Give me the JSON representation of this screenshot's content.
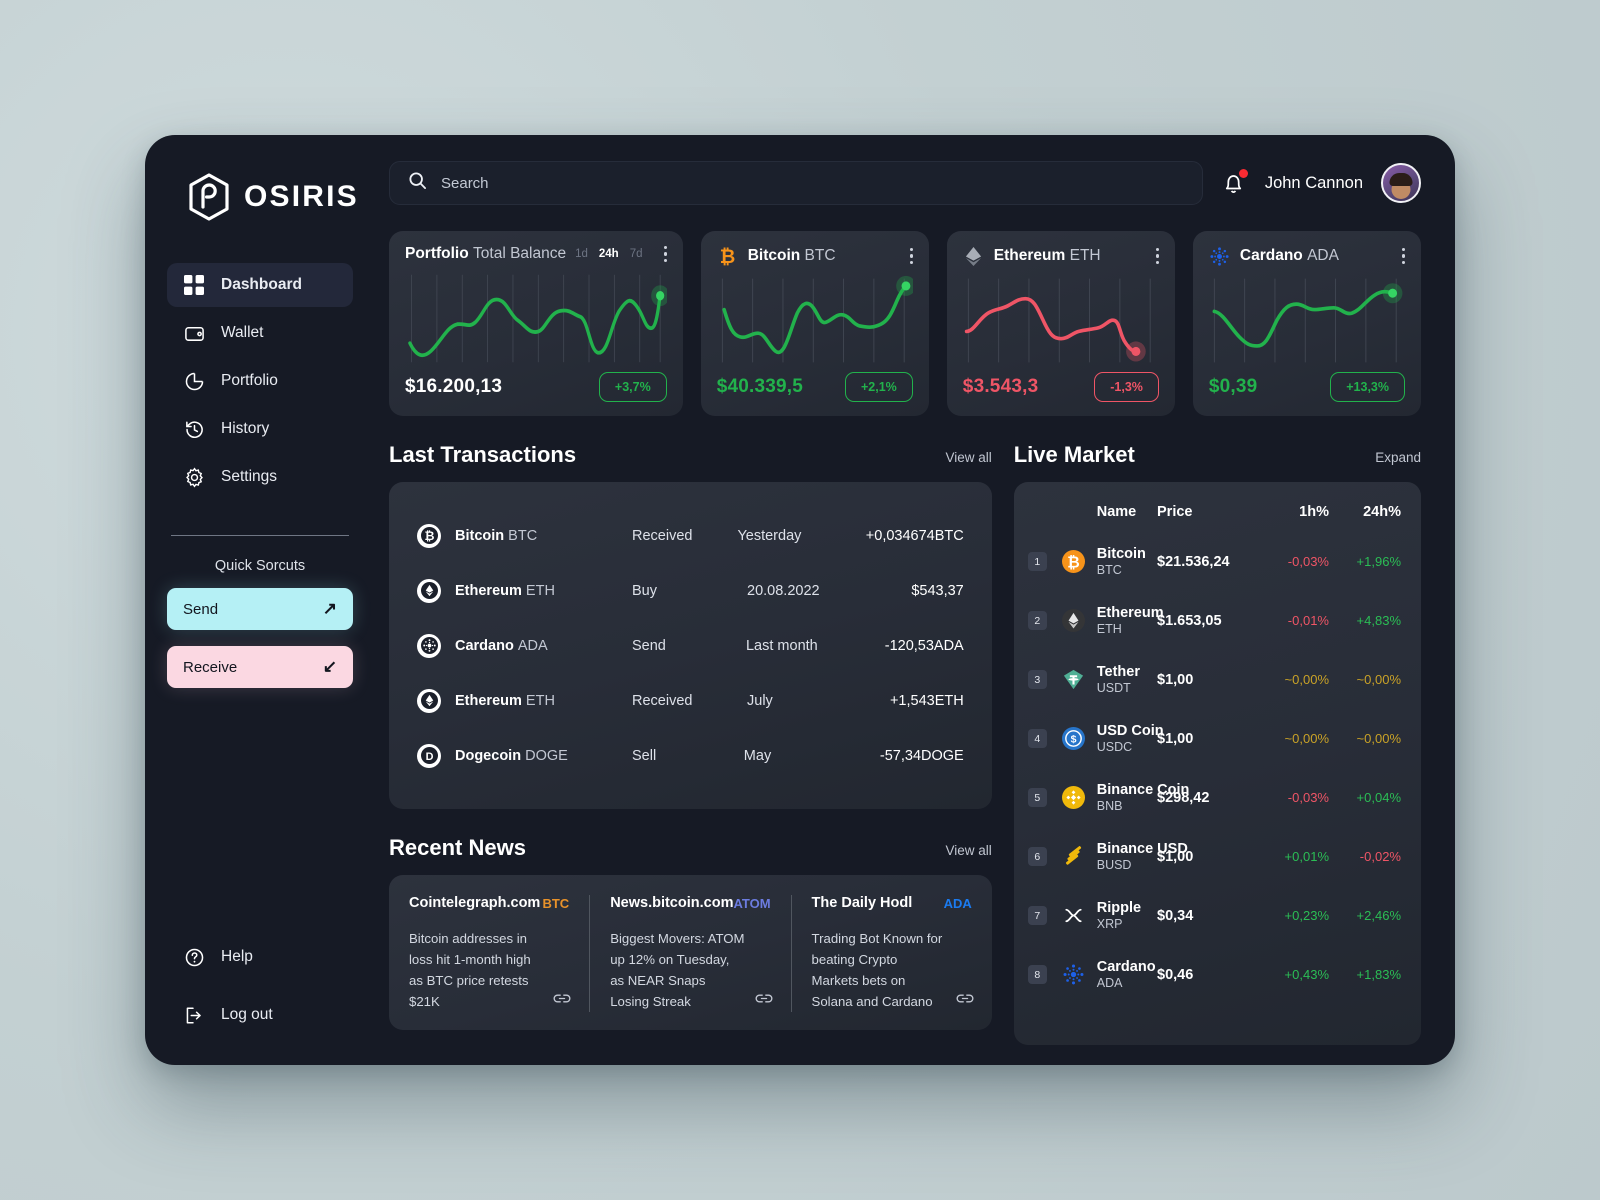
{
  "brand": {
    "name": "OSIRIS"
  },
  "sidebar": {
    "items": [
      {
        "label": "Dashboard",
        "icon": "grid-icon",
        "active": true
      },
      {
        "label": "Wallet",
        "icon": "wallet-icon",
        "active": false
      },
      {
        "label": "Portfolio",
        "icon": "pie-chart-icon",
        "active": false
      },
      {
        "label": "History",
        "icon": "history-icon",
        "active": false
      },
      {
        "label": "Settings",
        "icon": "gear-icon",
        "active": false
      }
    ],
    "quick_title": "Quick Sorcuts",
    "send_label": "Send",
    "receive_label": "Receive",
    "bottom": [
      {
        "label": "Help",
        "icon": "question-circle-icon"
      },
      {
        "label": "Log out",
        "icon": "logout-icon"
      }
    ]
  },
  "header": {
    "search_placeholder": "Search",
    "search_value": "",
    "user_name": "John Cannon",
    "has_notification": true
  },
  "price_cards": [
    {
      "title": "Portfolio",
      "subtitle": "Total Balance",
      "icon": "none",
      "ranges": [
        "1d",
        "24h",
        "7d"
      ],
      "active_range": "24h",
      "price": "$16.200,13",
      "price_color": "white",
      "change": "+3,7%",
      "direction": "up"
    },
    {
      "title": "Bitcoin",
      "subtitle": "BTC",
      "icon": "bitcoin-icon",
      "ranges": [],
      "active_range": "",
      "price": "$40.339,5",
      "price_color": "green",
      "change": "+2,1%",
      "direction": "up"
    },
    {
      "title": "Ethereum",
      "subtitle": "ETH",
      "icon": "ethereum-icon",
      "ranges": [],
      "active_range": "",
      "price": "$3.543,3",
      "price_color": "red",
      "change": "-1,3%",
      "direction": "down"
    },
    {
      "title": "Cardano",
      "subtitle": "ADA",
      "icon": "cardano-icon",
      "ranges": [],
      "active_range": "",
      "price": "$0,39",
      "price_color": "green",
      "change": "+13,3%",
      "direction": "up"
    }
  ],
  "transactions": {
    "title": "Last Transactions",
    "link": "View all",
    "rows": [
      {
        "coin": "Bitcoin",
        "ticker": "BTC",
        "icon": "bitcoin-icon",
        "type": "Received",
        "date": "Yesterday",
        "amount": "+0,034674BTC"
      },
      {
        "coin": "Ethereum",
        "ticker": "ETH",
        "icon": "ethereum-icon",
        "type": "Buy",
        "date": "20.08.2022",
        "amount": "$543,37"
      },
      {
        "coin": "Cardano",
        "ticker": "ADA",
        "icon": "cardano-icon",
        "type": "Send",
        "date": "Last month",
        "amount": "-120,53ADA"
      },
      {
        "coin": "Ethereum",
        "ticker": "ETH",
        "icon": "ethereum-icon",
        "type": "Received",
        "date": "July",
        "amount": "+1,543ETH"
      },
      {
        "coin": "Dogecoin",
        "ticker": "DOGE",
        "icon": "dogecoin-icon",
        "type": "Sell",
        "date": "May",
        "amount": "-57,34DOGE"
      }
    ]
  },
  "news": {
    "title": "Recent News",
    "link": "View all",
    "items": [
      {
        "source": "Cointelegraph.com",
        "tag": "BTC",
        "tag_color": "#e8922a",
        "text": "Bitcoin addresses in loss hit 1-month high as BTC price retests $21K"
      },
      {
        "source": "News.bitcoin.com",
        "tag": "ATOM",
        "tag_color": "#6c7ce0",
        "text": "Biggest Movers: ATOM up 12% on Tuesday, as NEAR Snaps Losing Streak"
      },
      {
        "source": "The Daily Hodl",
        "tag": "ADA",
        "tag_color": "#1b7bf0",
        "text": "Trading Bot Known for beating Crypto Markets bets on Solana and Cardano"
      }
    ]
  },
  "market": {
    "title": "Live Market",
    "link": "Expand",
    "columns": [
      "Name",
      "Price",
      "1h%",
      "24h%"
    ],
    "rows": [
      {
        "rank": "1",
        "name": "Bitcoin",
        "ticker": "BTC",
        "icon": "bitcoin-icon",
        "price": "$21.536,24",
        "h1": "-0,03%",
        "h1_dir": "down",
        "h24": "+1,96%",
        "h24_dir": "up"
      },
      {
        "rank": "2",
        "name": "Ethereum",
        "ticker": "ETH",
        "icon": "ethereum-icon",
        "price": "$1.653,05",
        "h1": "-0,01%",
        "h1_dir": "down",
        "h24": "+4,83%",
        "h24_dir": "up"
      },
      {
        "rank": "3",
        "name": "Tether",
        "ticker": "USDT",
        "icon": "tether-icon",
        "price": "$1,00",
        "h1": "~0,00%",
        "h1_dir": "flat",
        "h24": "~0,00%",
        "h24_dir": "flat"
      },
      {
        "rank": "4",
        "name": "USD Coin",
        "ticker": "USDC",
        "icon": "usdcoin-icon",
        "price": "$1,00",
        "h1": "~0,00%",
        "h1_dir": "flat",
        "h24": "~0,00%",
        "h24_dir": "flat"
      },
      {
        "rank": "5",
        "name": "Binance Coin",
        "ticker": "BNB",
        "icon": "binancecoin-icon",
        "price": "$298,42",
        "h1": "-0,03%",
        "h1_dir": "down",
        "h24": "+0,04%",
        "h24_dir": "up"
      },
      {
        "rank": "6",
        "name": "Binance USD",
        "ticker": "BUSD",
        "icon": "binanceusd-icon",
        "price": "$1,00",
        "h1": "+0,01%",
        "h1_dir": "up",
        "h24": "-0,02%",
        "h24_dir": "down"
      },
      {
        "rank": "7",
        "name": "Ripple",
        "ticker": "XRP",
        "icon": "ripple-icon",
        "price": "$0,34",
        "h1": "+0,23%",
        "h1_dir": "up",
        "h24": "+2,46%",
        "h24_dir": "up"
      },
      {
        "rank": "8",
        "name": "Cardano",
        "ticker": "ADA",
        "icon": "cardano-icon",
        "price": "$0,46",
        "h1": "+0,43%",
        "h1_dir": "up",
        "h24": "+1,83%",
        "h24_dir": "up"
      }
    ]
  },
  "colors": {
    "up": "#22b24c",
    "down": "#ef5566",
    "flat": "#c9a227",
    "panel": "#161a25",
    "card": "#2a2f3a",
    "accent_send": "#b5f0f5",
    "accent_receive": "#fbd8e2"
  },
  "chart_data": [
    {
      "type": "line",
      "title": "Portfolio Total Balance",
      "series_name": "Portfolio",
      "color": "#22b24c",
      "range": "24h",
      "grid": true,
      "legend": "none",
      "y": [
        28,
        52,
        72,
        68,
        50,
        38,
        62,
        72,
        70,
        42,
        12,
        66,
        52,
        80,
        74
      ],
      "end_value": "$16.200,13",
      "change_pct": 3.7
    },
    {
      "type": "line",
      "title": "Bitcoin BTC",
      "series_name": "BTC",
      "color": "#22b24c",
      "grid": true,
      "legend": "none",
      "y": [
        70,
        38,
        30,
        34,
        18,
        64,
        50,
        54,
        48,
        44,
        42,
        40,
        34,
        52,
        80
      ],
      "end_value": "$40.339,5",
      "change_pct": 2.1
    },
    {
      "type": "line",
      "title": "Ethereum ETH",
      "series_name": "ETH",
      "color": "#ef5566",
      "grid": true,
      "legend": "none",
      "y": [
        40,
        54,
        66,
        70,
        74,
        72,
        40,
        36,
        40,
        44,
        42,
        52,
        44,
        12,
        10
      ],
      "end_value": "$3.543,3",
      "change_pct": -1.3
    },
    {
      "type": "line",
      "title": "Cardano ADA",
      "series_name": "ADA",
      "color": "#22b24c",
      "grid": true,
      "legend": "none",
      "y": [
        62,
        48,
        28,
        18,
        16,
        40,
        62,
        58,
        56,
        58,
        50,
        48,
        62,
        74,
        78
      ],
      "end_value": "$0,39",
      "change_pct": 13.3
    }
  ]
}
